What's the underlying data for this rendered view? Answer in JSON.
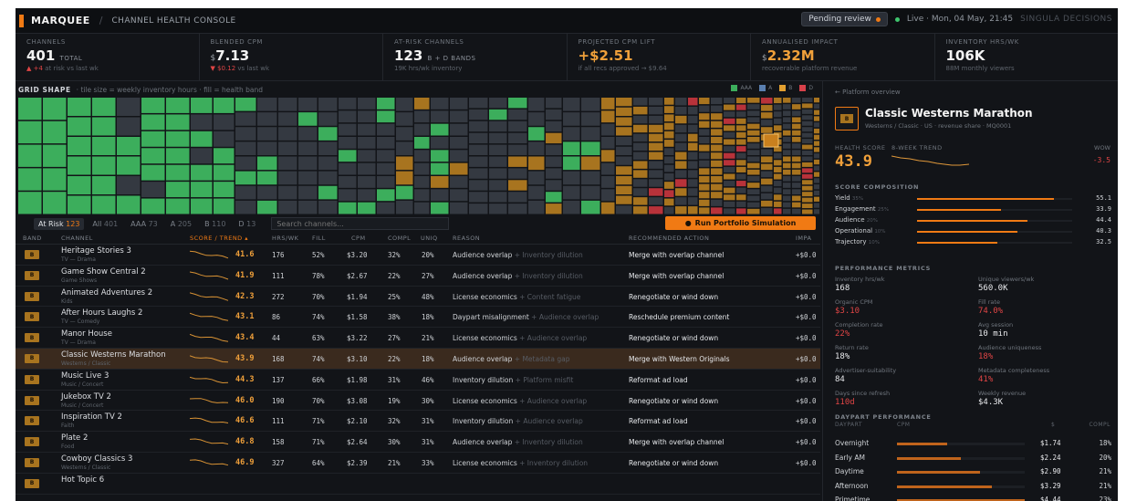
{
  "header": {
    "app_name": "MARQUEE",
    "console": "CHANNEL HEALTH CONSOLE",
    "pending": "Pending review",
    "live": "Live · Mon, 04 May, 21:45",
    "brand": "SINGULA DECISIONS"
  },
  "kpis": [
    {
      "label": "CHANNELS",
      "prefix": "",
      "value": "401",
      "unit": "TOTAL",
      "sub_a": "▲ +4",
      "sub_b": " at risk vs last wk"
    },
    {
      "label": "BLENDED CPM",
      "prefix": "$",
      "value": "7.13",
      "unit": "",
      "sub_a": "▼ $0.12",
      "sub_b": " vs last wk"
    },
    {
      "label": "AT-RISK CHANNELS",
      "prefix": "",
      "value": "123",
      "unit": "B + D BANDS",
      "sub_a": "",
      "sub_b": "19K hrs/wk inventory"
    },
    {
      "label": "PROJECTED CPM LIFT",
      "prefix": "",
      "value": "+$2.51",
      "unit": "",
      "sub_a": "",
      "sub_b": "if all recs approved → $9.64"
    },
    {
      "label": "ANNUALISED IMPACT",
      "prefix": "$",
      "value": "2.32M",
      "unit": "",
      "sub_a": "",
      "sub_b": "recoverable platform revenue"
    },
    {
      "label": "INVENTORY HRS/WK",
      "prefix": "",
      "value": "106K",
      "unit": "",
      "sub_a": "",
      "sub_b": "88M monthly viewers"
    }
  ],
  "grid": {
    "title": "GRID SHAPE",
    "desc": "· tile size = weekly inventory hours · fill = health band",
    "legend": [
      {
        "label": "AAA",
        "color": "#3cae5c"
      },
      {
        "label": "A",
        "color": "#5a7fb0"
      },
      {
        "label": "B",
        "color": "#e3a030"
      },
      {
        "label": "D",
        "color": "#d8414a"
      }
    ],
    "colors": {
      "green": "#3cae5c",
      "slate": "#343941",
      "amber": "#a8741f",
      "red": "#b8323a",
      "selected": "#c9801e"
    }
  },
  "filters": {
    "tabs": [
      {
        "label": "At Risk",
        "count": "123"
      },
      {
        "label": "All",
        "count": "401"
      },
      {
        "label": "AAA",
        "count": "73"
      },
      {
        "label": "A",
        "count": "205"
      },
      {
        "label": "B",
        "count": "110"
      },
      {
        "label": "D",
        "count": "13"
      }
    ],
    "search_placeholder": "Search channels...",
    "sim_label": "Run Portfolio Simulation"
  },
  "table": {
    "headers": {
      "band": "BAND",
      "channel": "CHANNEL",
      "score": "SCORE / TREND ▴",
      "hrs": "HRS/WK",
      "fill": "FILL",
      "cpm": "CPM",
      "compl": "COMPL",
      "uniq": "UNIQ",
      "reason": "REASON",
      "action": "RECOMMENDED ACTION",
      "impact": "IMPA"
    },
    "rows": [
      {
        "band": "B",
        "name": "Heritage Stories 3",
        "genre": "TV — Drama",
        "score": "41.6",
        "hrs": "176",
        "fill": "52%",
        "cpm": "$3.20",
        "compl": "32%",
        "uniq": "20%",
        "reason": "Audience overlap",
        "reason2": "+ Inventory dilution",
        "action": "Merge with overlap channel",
        "impact": "+$0.0"
      },
      {
        "band": "B",
        "name": "Game Show Central 2",
        "genre": "Game Shows",
        "score": "41.9",
        "hrs": "111",
        "fill": "78%",
        "cpm": "$2.67",
        "compl": "22%",
        "uniq": "27%",
        "reason": "Audience overlap",
        "reason2": "+ Inventory dilution",
        "action": "Merge with overlap channel",
        "impact": "+$0.0"
      },
      {
        "band": "B",
        "name": "Animated Adventures 2",
        "genre": "Kids",
        "score": "42.3",
        "hrs": "272",
        "fill": "70%",
        "cpm": "$1.94",
        "compl": "25%",
        "uniq": "48%",
        "reason": "License economics",
        "reason2": "+ Content fatigue",
        "action": "Renegotiate or wind down",
        "impact": "+$0.0"
      },
      {
        "band": "B",
        "name": "After Hours Laughs 2",
        "genre": "TV — Comedy",
        "score": "43.1",
        "hrs": "86",
        "fill": "74%",
        "cpm": "$1.58",
        "compl": "38%",
        "uniq": "18%",
        "reason": "Daypart misalignment",
        "reason2": "+ Audience overlap",
        "action": "Reschedule premium content",
        "impact": "+$0.0"
      },
      {
        "band": "B",
        "name": "Manor House",
        "genre": "TV — Drama",
        "score": "43.4",
        "hrs": "44",
        "fill": "63%",
        "cpm": "$3.22",
        "compl": "27%",
        "uniq": "21%",
        "reason": "License economics",
        "reason2": "+ Audience overlap",
        "action": "Renegotiate or wind down",
        "impact": "+$0.0"
      },
      {
        "band": "B",
        "name": "Classic Westerns Marathon",
        "genre": "Westerns / Classic",
        "score": "43.9",
        "hrs": "168",
        "fill": "74%",
        "cpm": "$3.10",
        "compl": "22%",
        "uniq": "18%",
        "reason": "Audience overlap",
        "reason2": "+ Metadata gap",
        "action": "Merge with Western Originals",
        "impact": "+$0.0"
      },
      {
        "band": "B",
        "name": "Music Live 3",
        "genre": "Music / Concert",
        "score": "44.3",
        "hrs": "137",
        "fill": "66%",
        "cpm": "$1.98",
        "compl": "31%",
        "uniq": "46%",
        "reason": "Inventory dilution",
        "reason2": "+ Platform misfit",
        "action": "Reformat ad load",
        "impact": "+$0.0"
      },
      {
        "band": "B",
        "name": "Jukebox TV 2",
        "genre": "Music / Concert",
        "score": "46.0",
        "hrs": "190",
        "fill": "70%",
        "cpm": "$3.08",
        "compl": "19%",
        "uniq": "30%",
        "reason": "License economics",
        "reason2": "+ Audience overlap",
        "action": "Renegotiate or wind down",
        "impact": "+$0.0"
      },
      {
        "band": "B",
        "name": "Inspiration TV 2",
        "genre": "Faith",
        "score": "46.6",
        "hrs": "111",
        "fill": "71%",
        "cpm": "$2.10",
        "compl": "32%",
        "uniq": "31%",
        "reason": "Inventory dilution",
        "reason2": "+ Audience overlap",
        "action": "Reformat ad load",
        "impact": "+$0.0"
      },
      {
        "band": "B",
        "name": "Plate 2",
        "genre": "Food",
        "score": "46.8",
        "hrs": "158",
        "fill": "71%",
        "cpm": "$2.64",
        "compl": "30%",
        "uniq": "31%",
        "reason": "Audience overlap",
        "reason2": "+ Inventory dilution",
        "action": "Merge with overlap channel",
        "impact": "+$0.0"
      },
      {
        "band": "B",
        "name": "Cowboy Classics 3",
        "genre": "Westerns / Classic",
        "score": "46.9",
        "hrs": "327",
        "fill": "64%",
        "cpm": "$2.39",
        "compl": "21%",
        "uniq": "33%",
        "reason": "License economics",
        "reason2": "+ Inventory dilution",
        "action": "Renegotiate or wind down",
        "impact": "+$0.0"
      },
      {
        "band": "B",
        "name": "Hot Topic 6",
        "genre": "",
        "score": "",
        "hrs": "",
        "fill": "",
        "cpm": "",
        "compl": "",
        "uniq": "",
        "reason": "",
        "reason2": "",
        "action": "",
        "impact": ""
      }
    ]
  },
  "panel": {
    "back": "← Platform overview",
    "band": "B",
    "title": "Classic Westerns Marathon",
    "meta": "Westerns / Classic · US · revenue share · MQ0001",
    "health_label": "HEALTH SCORE",
    "trend_label": "8-WEEK TREND",
    "wow_label": "WOW",
    "health_value": "43.9",
    "wow_value": "-3.5",
    "composition_title": "SCORE COMPOSITION",
    "composition": [
      {
        "name": "Yield",
        "weight": "35%",
        "value": "55.1"
      },
      {
        "name": "Engagement",
        "weight": "25%",
        "value": "33.9"
      },
      {
        "name": "Audience",
        "weight": "20%",
        "value": "44.4"
      },
      {
        "name": "Operational",
        "weight": "10%",
        "value": "40.3"
      },
      {
        "name": "Trajectory",
        "weight": "10%",
        "value": "32.5"
      }
    ],
    "metrics_title": "PERFORMANCE METRICS",
    "metrics": [
      {
        "label": "Inventory hrs/wk",
        "value": "168",
        "bad": false
      },
      {
        "label": "Unique viewers/wk",
        "value": "560.0K",
        "bad": false
      },
      {
        "label": "Organic CPM",
        "value": "$3.10",
        "bad": true
      },
      {
        "label": "Fill rate",
        "value": "74.0%",
        "bad": true
      },
      {
        "label": "Completion rate",
        "value": "22%",
        "bad": true
      },
      {
        "label": "Avg session",
        "value": "10 min",
        "bad": false
      },
      {
        "label": "Return rate",
        "value": "18%",
        "bad": false
      },
      {
        "label": "Audience uniqueness",
        "value": "18%",
        "bad": true
      },
      {
        "label": "Advertiser-suitability",
        "value": "84",
        "bad": false
      },
      {
        "label": "Metadata completeness",
        "value": "41%",
        "bad": true
      },
      {
        "label": "Days since refresh",
        "value": "110d",
        "bad": true
      },
      {
        "label": "Weekly revenue",
        "value": "$4.3K",
        "bad": false
      }
    ],
    "daypart_title": "DAYPART PERFORMANCE",
    "daypart_headers": {
      "daypart": "DAYPART",
      "cpm": "CPM",
      "dollar": "$",
      "compl": "COMPL"
    },
    "dayparts": [
      {
        "name": "Overnight",
        "cpm": "$1.74",
        "compl": "18%",
        "level": 0.39
      },
      {
        "name": "Early AM",
        "cpm": "$2.24",
        "compl": "20%",
        "level": 0.5
      },
      {
        "name": "Daytime",
        "cpm": "$2.90",
        "compl": "21%",
        "level": 0.65
      },
      {
        "name": "Afternoon",
        "cpm": "$3.29",
        "compl": "21%",
        "level": 0.74
      },
      {
        "name": "Primetime",
        "cpm": "$4.44",
        "compl": "23%",
        "level": 1.0
      }
    ]
  }
}
